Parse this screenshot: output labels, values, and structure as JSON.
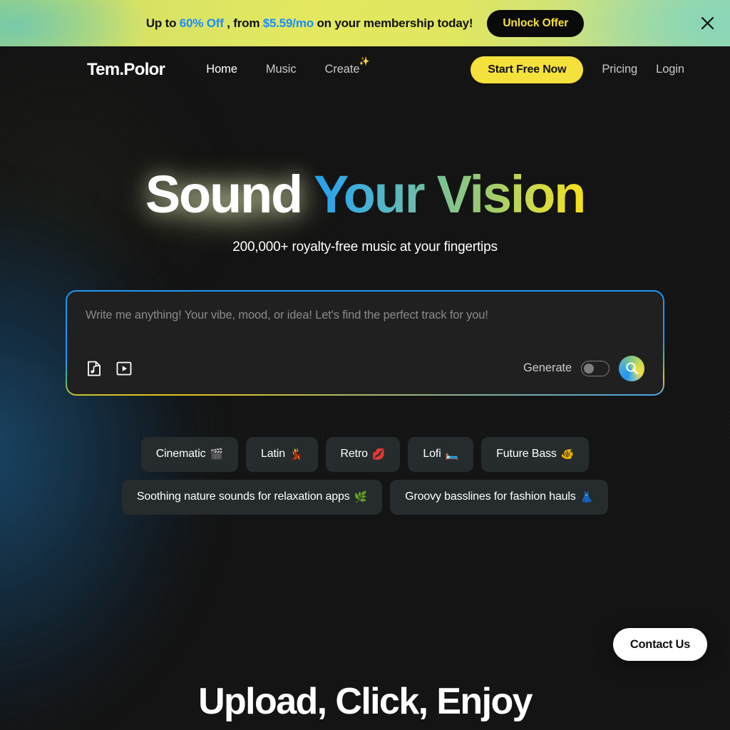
{
  "promo": {
    "prefix": "Up to ",
    "discount": "60% Off",
    "middle": " , from ",
    "price": "$5.59/mo",
    "suffix": " on your membership today!",
    "cta_label": "Unlock Offer",
    "close_icon": "close-icon"
  },
  "nav": {
    "logo": "Tem.Polor",
    "links": [
      {
        "label": "Home",
        "active": true
      },
      {
        "label": "Music",
        "active": false
      },
      {
        "label": "Create",
        "active": false,
        "sparkle": "✨"
      }
    ],
    "cta_label": "Start Free Now",
    "pricing_label": "Pricing",
    "login_label": "Login"
  },
  "hero": {
    "title_white": "Sound",
    "title_gradient": " Your Vision",
    "subtitle": "200,000+ royalty-free music at your fingertips",
    "gradient_colors": [
      "#1e9bf0",
      "#7cc292",
      "#f7e016"
    ]
  },
  "search": {
    "placeholder": "Write me anything! Your vibe, mood, or idea! Let's find the perfect track for you!",
    "value": "",
    "music_file_icon": "music-file-icon",
    "video_file_icon": "video-file-icon",
    "generate_label": "Generate",
    "generate_on": false,
    "submit_icon": "search-icon",
    "border_accent": "#2196f3"
  },
  "chips": {
    "row1": [
      {
        "label": "Cinematic",
        "emoji": "🎬"
      },
      {
        "label": "Latin",
        "emoji": "💃"
      },
      {
        "label": "Retro",
        "emoji": "💋"
      },
      {
        "label": "Lofi",
        "emoji": "🛏️"
      },
      {
        "label": "Future Bass",
        "emoji": "🐠"
      }
    ],
    "row2": [
      {
        "label": "Soothing nature sounds for relaxation apps",
        "emoji": "🌿"
      },
      {
        "label": "Groovy basslines for fashion hauls",
        "emoji": "👗"
      }
    ]
  },
  "contact": {
    "label": "Contact Us"
  },
  "next_section": {
    "title": "Upload, Click, Enjoy"
  }
}
